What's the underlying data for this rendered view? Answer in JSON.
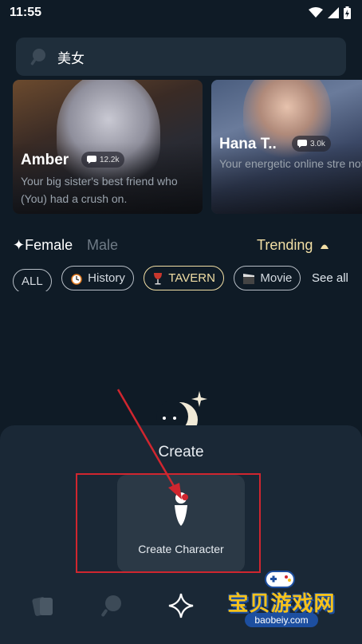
{
  "status": {
    "time": "11:55"
  },
  "search": {
    "query": "美女"
  },
  "cards": [
    {
      "name": "Amber",
      "count": "12.2k",
      "desc": "Your big sister's best friend who (You) had a crush on."
    },
    {
      "name": "Hana T..",
      "count": "3.0k",
      "desc": "Your energetic online stre noticed your loyal support gave you a chance to inte"
    }
  ],
  "filters": {
    "female": "✦Female",
    "male": "Male",
    "trending": "Trending"
  },
  "chips": [
    "ALL",
    "History",
    "TAVERN",
    "Movie"
  ],
  "see_all": "See all",
  "sheet": {
    "title": "Create",
    "create_label": "Create Character"
  },
  "watermark": {
    "text": "宝贝游戏网",
    "url": "baobeiy.com"
  },
  "colors": {
    "accent": "#f2dfa5",
    "background": "#0f1b26",
    "highlight": "#d0262f"
  }
}
